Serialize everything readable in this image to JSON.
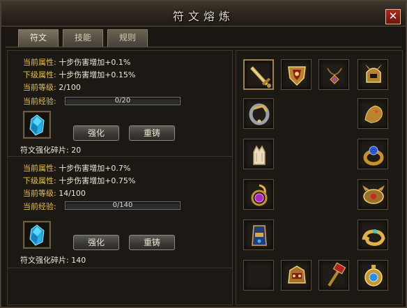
{
  "window": {
    "title": "符文熔炼",
    "close_label": "✕"
  },
  "tabs": [
    {
      "label": "符文"
    },
    {
      "label": "技能"
    },
    {
      "label": "规则"
    }
  ],
  "runes": [
    {
      "current_attr_label": "当前属性:",
      "current_attr_value": "十步伤害增加+0.1%",
      "next_attr_label": "下级属性:",
      "next_attr_value": "十步伤害增加+0.15%",
      "level_label": "当前等级:",
      "level_value": "2/100",
      "exp_label": "当前经验:",
      "exp_text": "0/20",
      "exp_fraction": 0.0,
      "strengthen_label": "强化",
      "recast_label": "重铸",
      "fragments_label": "符文强化碎片:",
      "fragments_value": "20"
    },
    {
      "current_attr_label": "当前属性:",
      "current_attr_value": "十步伤害增加+0.7%",
      "next_attr_label": "下级属性:",
      "next_attr_value": "十步伤害增加+0.75%",
      "level_label": "当前等级:",
      "level_value": "14/100",
      "exp_label": "当前经验:",
      "exp_text": "0/140",
      "exp_fraction": 0.0,
      "strengthen_label": "强化",
      "recast_label": "重铸",
      "fragments_label": "符文强化碎片:",
      "fragments_value": "140"
    }
  ],
  "equipment_slots": [
    {
      "icon": "sword-icon",
      "selected": true
    },
    {
      "icon": "shield-icon"
    },
    {
      "icon": "necklace-icon"
    },
    {
      "icon": "helmet-icon"
    },
    {
      "icon": "bracelet-icon"
    },
    {
      "icon": "dragon-ring-icon"
    },
    {
      "icon": "glove-icon"
    },
    {
      "icon": "sapphire-ring-icon"
    },
    {
      "icon": "amethyst-ring-icon"
    },
    {
      "icon": "horned-medal-icon"
    },
    {
      "icon": "blue-belt-icon"
    },
    {
      "icon": "serpent-ring-icon"
    },
    {
      "icon": "empty-slot"
    },
    {
      "icon": "dragon-head-icon"
    },
    {
      "icon": "hammer-icon"
    },
    {
      "icon": "orb-medal-icon"
    }
  ],
  "colors": {
    "label_yellow": "#e6c04a",
    "value_white": "#efe7d6",
    "rune_blue": "#2fc8f0"
  }
}
